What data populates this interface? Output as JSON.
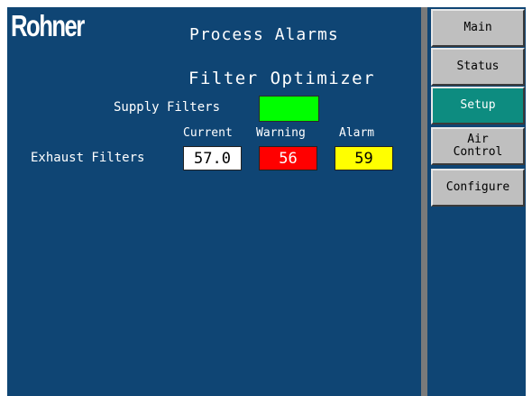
{
  "brand": {
    "logo_text": "Rohner"
  },
  "header": {
    "title": "Process Alarms",
    "subtitle": "Filter Optimizer"
  },
  "supply": {
    "label": "Supply Filters",
    "status_color": "#00ff00"
  },
  "exhaust": {
    "label": "Exhaust Filters",
    "columns": {
      "current": "Current",
      "warning": "Warning",
      "alarm": "Alarm"
    },
    "current_value": "57.0",
    "warning_value": "56",
    "alarm_value": "59"
  },
  "colors": {
    "background": "#0f4574",
    "warning_bg": "#ff0000",
    "alarm_bg": "#ffff00",
    "active_button": "#0d8c80",
    "button_bg": "#bfbfbf"
  },
  "nav": {
    "main": "Main",
    "status": "Status",
    "setup": "Setup",
    "air_control_line1": "Air",
    "air_control_line2": "Control",
    "configure": "Configure",
    "active": "Setup"
  }
}
